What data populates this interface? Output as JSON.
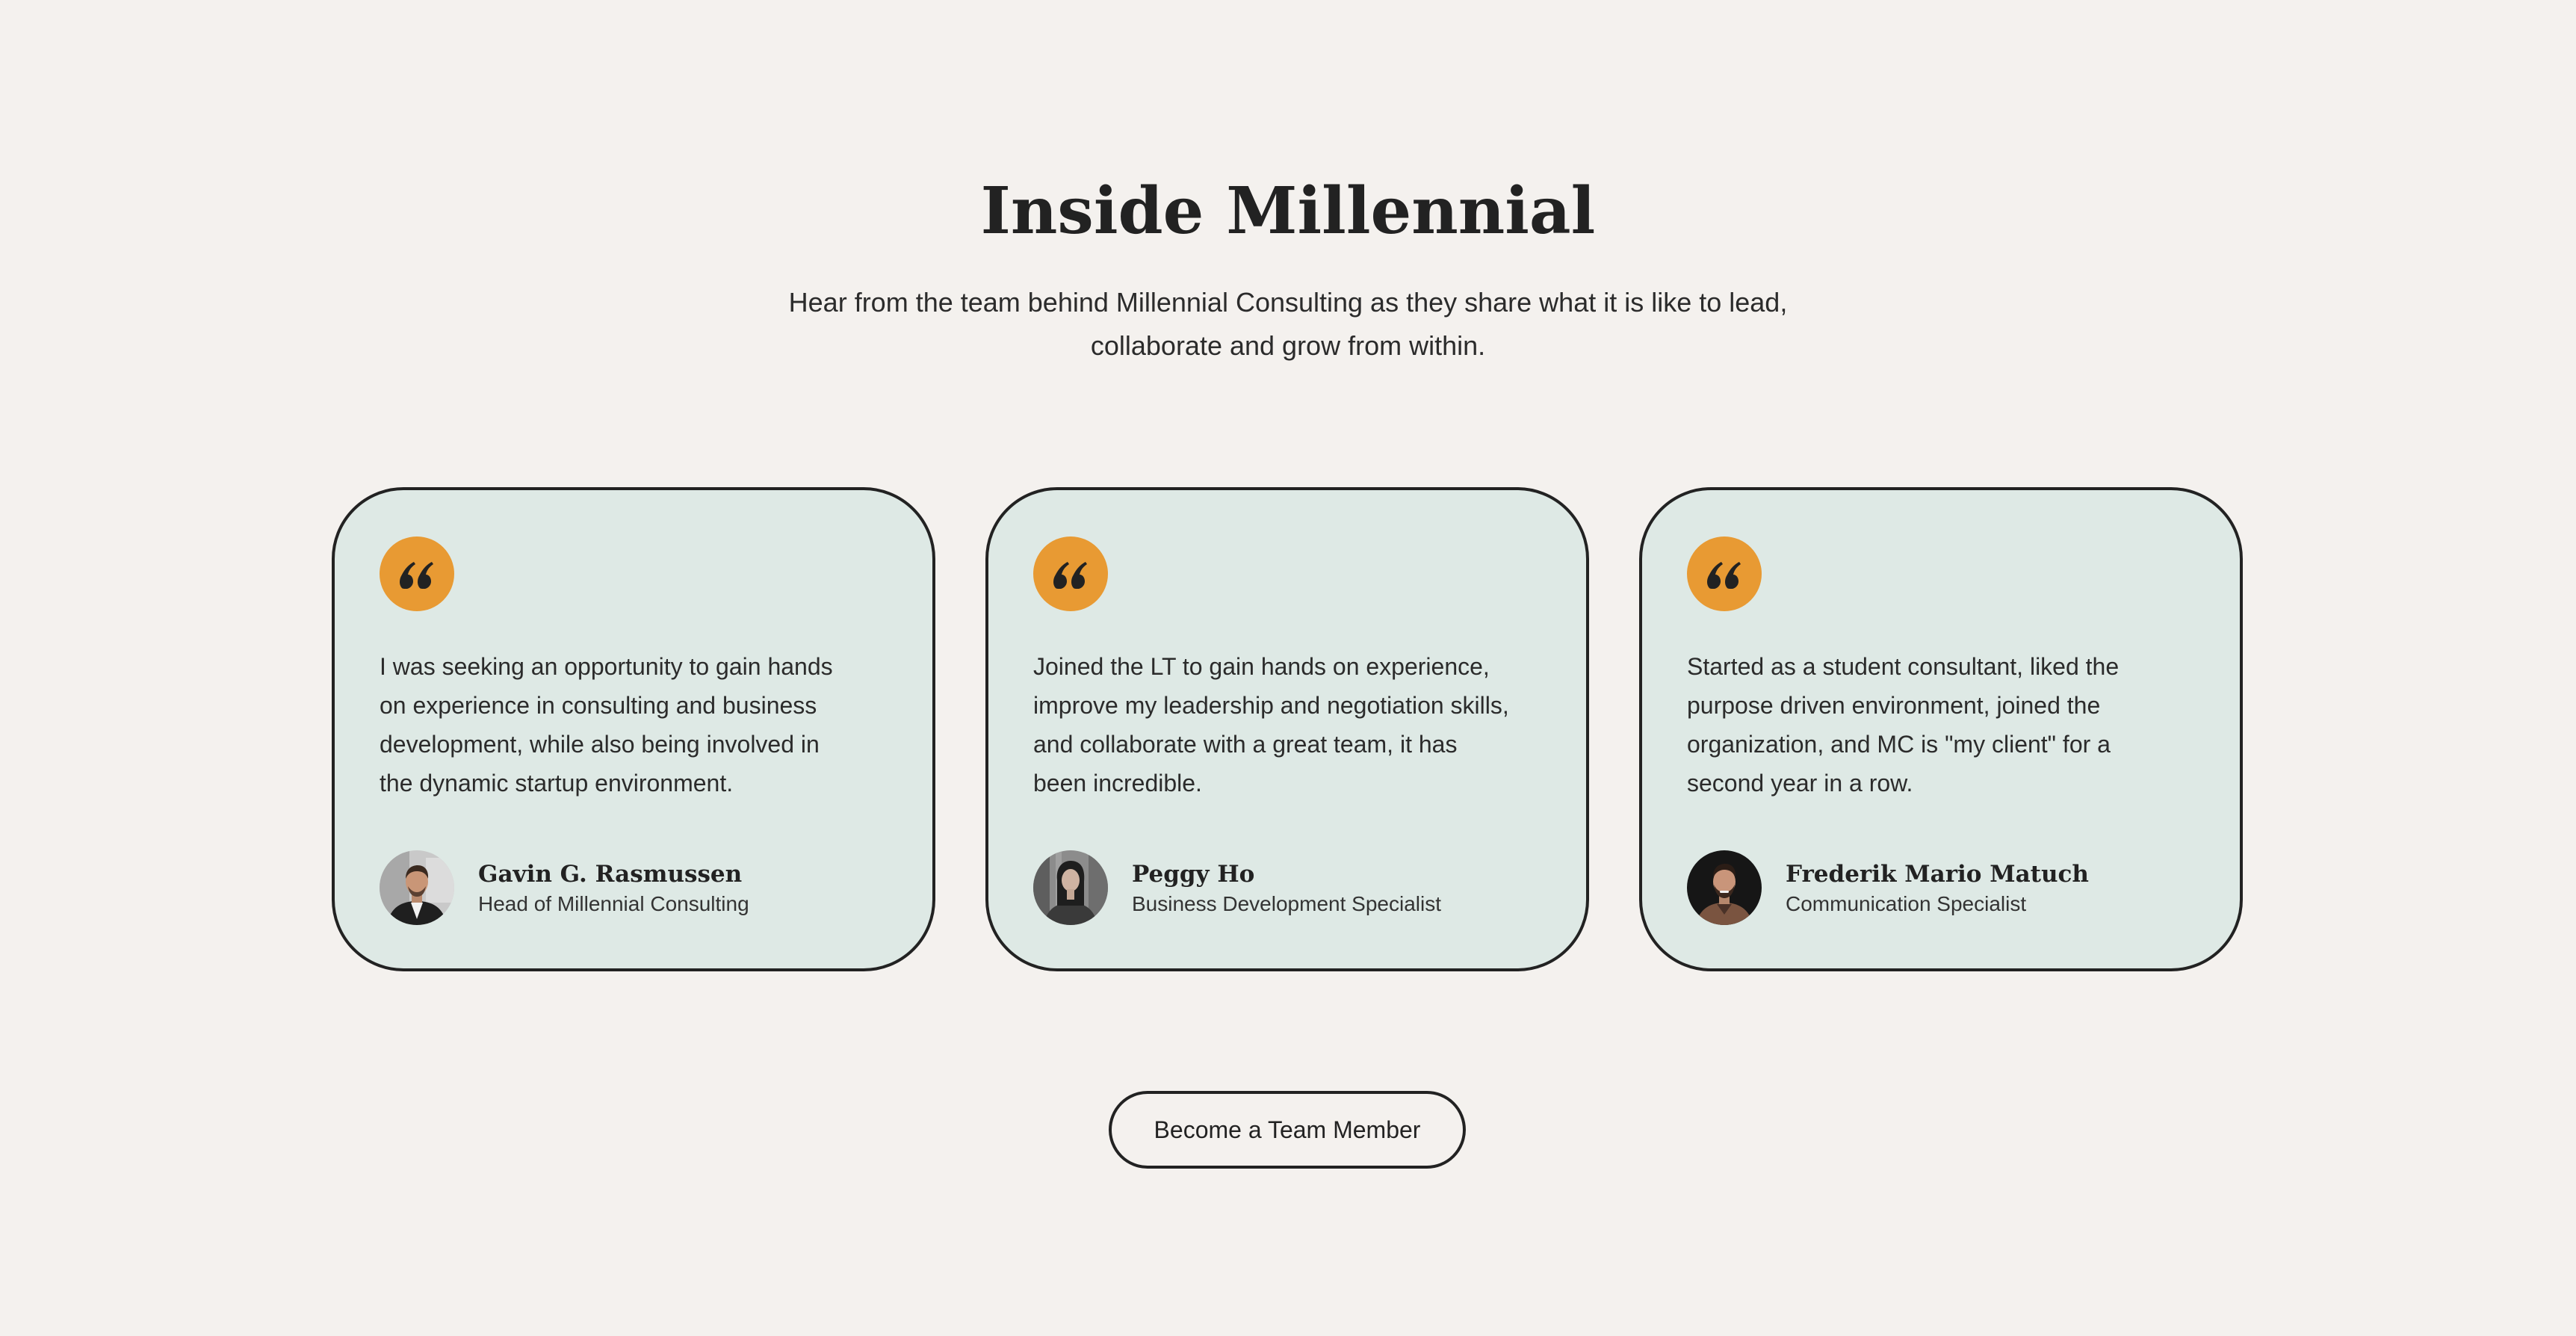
{
  "section": {
    "title": "Inside Millennial",
    "subtitle_line1": "Hear from the team behind Millennial Consulting as they share what it is like to lead,",
    "subtitle_line2": "collaborate and grow from within."
  },
  "colors": {
    "background": "#f4f1ee",
    "card": "#dee9e5",
    "accent": "#e89a33",
    "border": "#222222"
  },
  "testimonials": [
    {
      "icon": "quote-icon",
      "quote_lines": [
        "I was seeking an opportunity to gain hands",
        "on experience in consulting and business",
        "development, while also being involved in",
        "the dynamic startup environment."
      ],
      "name": "Gavin G. Rasmussen",
      "role": "Head of Millennial Consulting"
    },
    {
      "icon": "quote-icon",
      "quote_lines": [
        "Joined the LT to gain hands on experience,",
        "improve my leadership and negotiation skills,",
        "and collaborate with a great team, it has",
        "been incredible."
      ],
      "name": "Peggy Ho",
      "role": "Business Development Specialist"
    },
    {
      "icon": "quote-icon",
      "quote_lines": [
        "Started as a student consultant, liked the",
        "purpose driven environment, joined the",
        "organization, and MC is \"my client\" for a",
        "second year in a row."
      ],
      "name": "Frederik Mario Matuch",
      "role": "Communication Specialist"
    }
  ],
  "cta": {
    "label": "Become a Team Member"
  }
}
